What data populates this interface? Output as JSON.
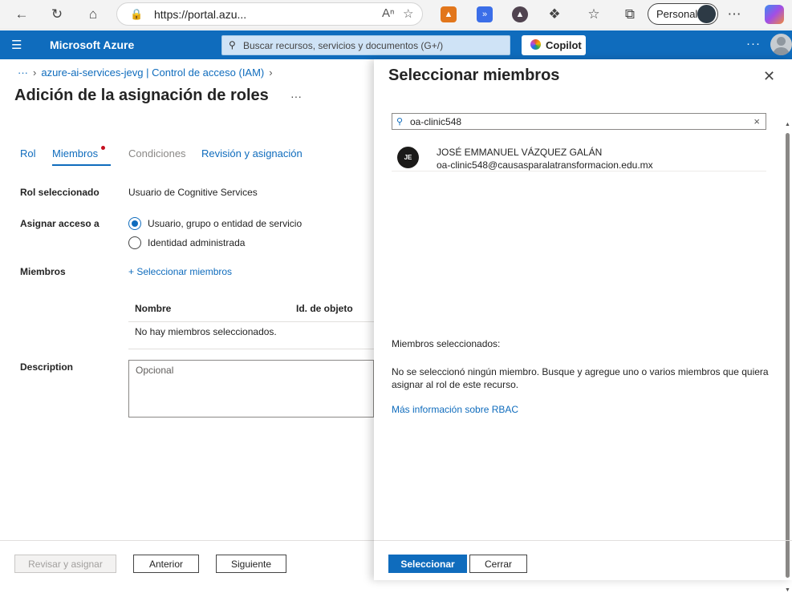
{
  "browser": {
    "url": "https://portal.azu...",
    "profile_label": "Personal"
  },
  "azure": {
    "brand": "Microsoft Azure",
    "search_placeholder": "Buscar recursos, servicios y documentos (G+/)",
    "copilot_label": "Copilot"
  },
  "breadcrumb": {
    "ellipsis": "···",
    "item": "azure-ai-services-jevg | Control de acceso (IAM)"
  },
  "page": {
    "title": "Adición de la asignación de roles",
    "more": "···",
    "tabs": [
      {
        "label": "Rol",
        "state": "normal"
      },
      {
        "label": "Miembros",
        "state": "active"
      },
      {
        "label": "Condiciones",
        "state": "disabled"
      },
      {
        "label": "Revisión y asignación",
        "state": "normal"
      }
    ],
    "rol_label": "Rol seleccionado",
    "rol_value": "Usuario de Cognitive Services",
    "assign_label": "Asignar acceso a",
    "assign_options": [
      "Usuario, grupo o entidad de servicio",
      "Identidad administrada"
    ],
    "members_label": "Miembros",
    "select_members_link": "+ Seleccionar miembros",
    "table_headers": [
      "Nombre",
      "Id. de objeto"
    ],
    "table_empty": "No hay miembros seleccionados.",
    "description_label": "Description",
    "description_placeholder": "Opcional",
    "buttons": {
      "review": "Revisar y asignar",
      "previous": "Anterior",
      "next": "Siguiente"
    }
  },
  "panel": {
    "title": "Seleccionar miembros",
    "search_value": "oa-clinic548",
    "results": [
      {
        "initials": "JE",
        "name": "JOSÉ EMMANUEL VÁZQUEZ GALÁN",
        "email": "oa-clinic548@causasparalatransformacion.edu.mx"
      }
    ],
    "selected_heading": "Miembros seleccionados:",
    "selected_message": "No se seleccionó ningún miembro. Busque y agregue uno o varios miembros que quiera asignar al rol de este recurso.",
    "rbac_link": "Más información sobre RBAC",
    "buttons": {
      "select": "Seleccionar",
      "close": "Cerrar"
    }
  },
  "colors": {
    "azure_blue": "#0f6cbd",
    "required_dot": "#c50f1f"
  }
}
